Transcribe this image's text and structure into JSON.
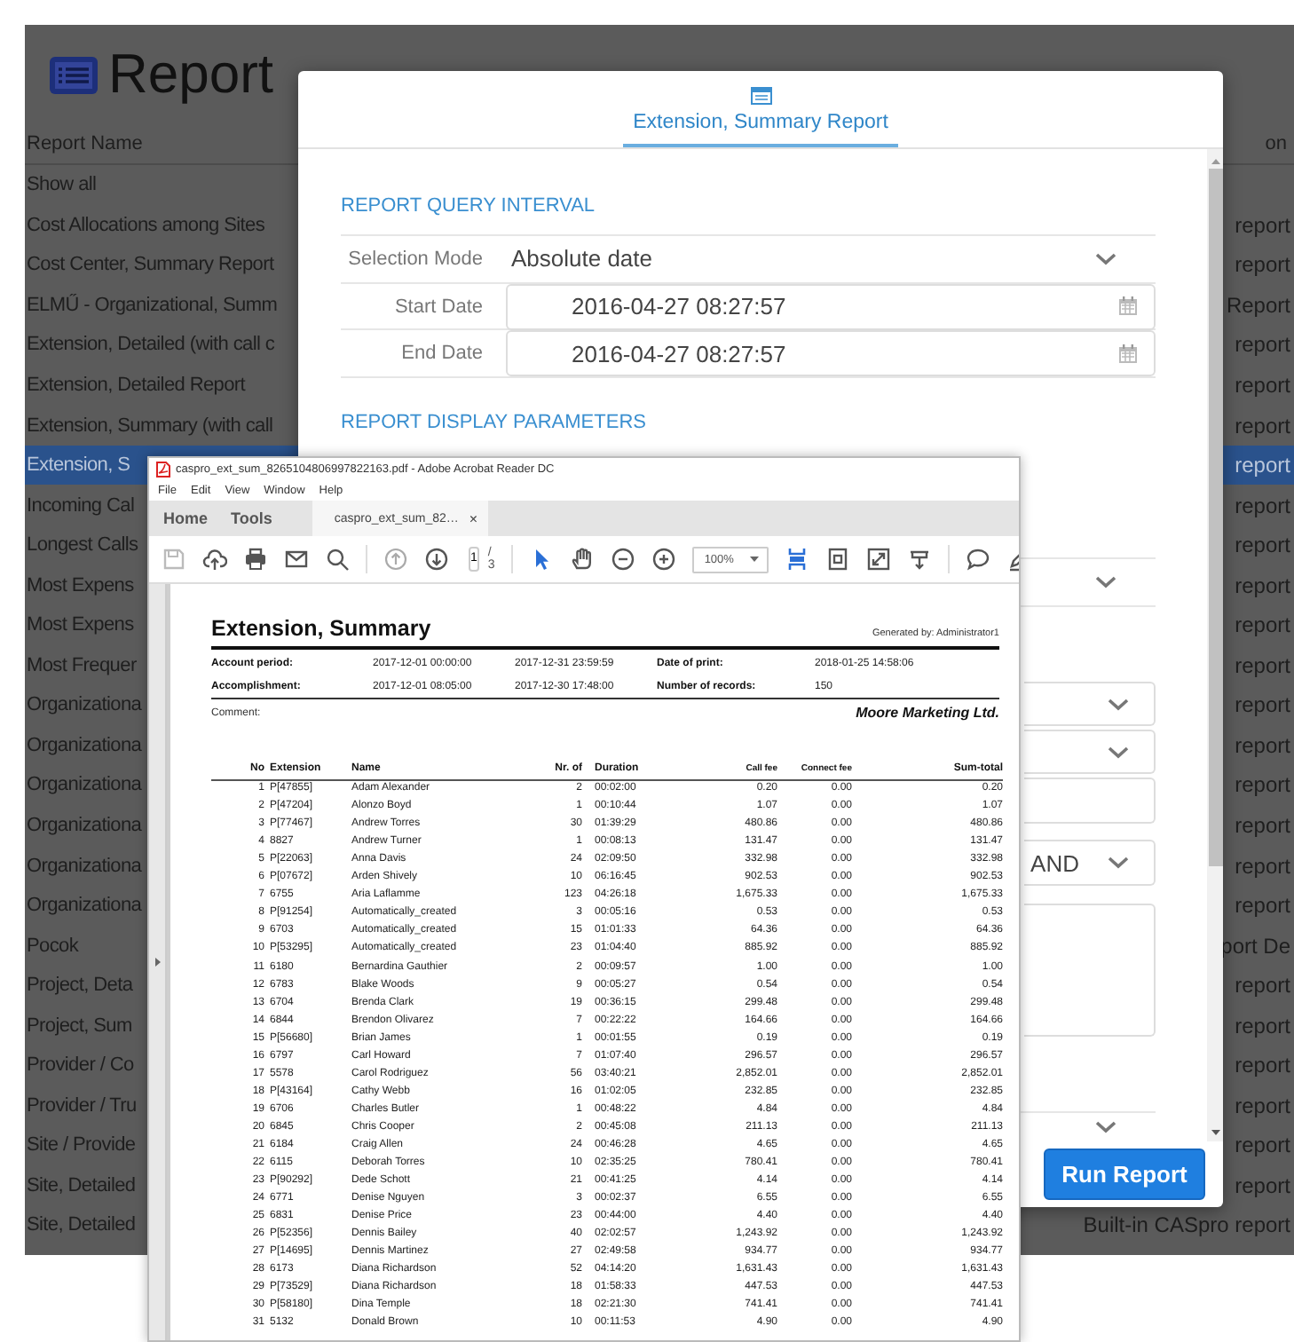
{
  "page": {
    "title": "Report",
    "columns": [
      "Report Name",
      "on"
    ],
    "rows": [
      {
        "report_name": "Show all",
        "selected": false
      },
      {
        "report_name": "Cost Allocations among Sites",
        "column_2": "report",
        "selected": false
      },
      {
        "report_name": "Cost Center, Summary Report",
        "column_2": "report",
        "selected": false
      },
      {
        "report_name": "ELMŰ - Organizational, Summ",
        "column_2": "Report",
        "selected": false
      },
      {
        "report_name": "Extension, Detailed (with call c",
        "column_2": "report",
        "selected": false
      },
      {
        "report_name": "Extension, Detailed Report",
        "column_2": "report",
        "selected": false
      },
      {
        "report_name": "Extension, Summary (with call",
        "column_2": "report",
        "selected": false
      },
      {
        "report_name": "Extension, S",
        "column_2": "report",
        "selected": true
      },
      {
        "report_name": "Incoming Cal",
        "column_2": "report",
        "selected": false
      },
      {
        "report_name": "Longest Calls",
        "column_2": "report",
        "selected": false
      },
      {
        "report_name": "Most Expens",
        "column_2": "report",
        "selected": false
      },
      {
        "report_name": "Most Expens",
        "column_2": "report",
        "selected": false
      },
      {
        "report_name": "Most Frequer",
        "column_2": "report",
        "selected": false
      },
      {
        "report_name": "Organizationa",
        "column_2": "report",
        "selected": false
      },
      {
        "report_name": "Organizationa",
        "column_2": "report",
        "selected": false
      },
      {
        "report_name": "Organizationa",
        "column_2": "report",
        "selected": false
      },
      {
        "report_name": "Organizationa",
        "column_2": "report",
        "selected": false
      },
      {
        "report_name": "Organizationa",
        "column_2": "report",
        "selected": false
      },
      {
        "report_name": "Organizationa",
        "column_2": "report",
        "selected": false
      },
      {
        "report_name": "Pocok",
        "column_2": "port De",
        "selected": false
      },
      {
        "report_name": "Project, Deta",
        "column_2": "report",
        "selected": false
      },
      {
        "report_name": "Project, Sum",
        "column_2": "report",
        "selected": false
      },
      {
        "report_name": "Provider / Co",
        "column_2": "report",
        "selected": false
      },
      {
        "report_name": "Provider / Tru",
        "column_2": "report",
        "selected": false
      },
      {
        "report_name": "Site / Provide",
        "column_2": "report",
        "selected": false
      },
      {
        "report_name": "Site, Detailed",
        "column_2": "report",
        "selected": false
      },
      {
        "report_name": "Site, Detailed",
        "column_2": "Built-in CASpro report",
        "selected": false
      }
    ]
  },
  "modal": {
    "tab": {
      "label": "Extension, Summary Report",
      "selected": true
    },
    "query_title": "REPORT QUERY INTERVAL",
    "query_fields": [
      {
        "kind": "select",
        "label": "Selection Mode",
        "value": "Absolute date"
      },
      {
        "kind": "date",
        "label": "Start Date",
        "value": "2016-04-27 08:27:57"
      },
      {
        "kind": "date",
        "label": "End Date",
        "value": "2016-04-27 08:27:57"
      }
    ],
    "display_title": "REPORT DISPLAY PARAMETERS",
    "display_fields": [
      {
        "kind": "select-row"
      },
      {
        "kind": "select"
      },
      {
        "kind": "select"
      },
      {
        "kind": "input"
      },
      {
        "kind": "select",
        "value": "AND"
      },
      {
        "kind": "textarea"
      },
      {
        "kind": "select-row"
      }
    ],
    "run_button": "Run Report"
  },
  "pdf": {
    "title": "caspro_ext_sum_8265104806997822163.pdf - Adobe Acrobat Reader DC",
    "menu": [
      "File",
      "Edit",
      "View",
      "Window",
      "Help"
    ],
    "nav": [
      "Home",
      "Tools"
    ],
    "tab": {
      "label": "caspro_ext_sum_82…",
      "close": "×",
      "selected": true
    },
    "page_number": "1",
    "page_count": "/ 3",
    "zoom": "100%",
    "document": {
      "title": "Extension, Summary",
      "generated_by": "Generated by: Administrator1",
      "info": [
        [
          "Account period:",
          "2017-12-01 00:00:00",
          "2017-12-31 23:59:59",
          "Date of print:",
          "2018-01-25 14:58:06"
        ],
        [
          "Accomplishment:",
          "2017-12-01 08:05:00",
          "2017-12-30 17:48:00",
          "Number of records:",
          "150"
        ]
      ],
      "comment_label": "Comment:",
      "company": "Moore Marketing Ltd.",
      "columns": [
        "No",
        "Extension",
        "Name",
        "Nr. of",
        "Duration",
        "Call fee",
        "Connect fee",
        "Sum-total"
      ],
      "rows": [
        [
          "1",
          "P[47855]",
          "Adam Alexander",
          "2",
          "00:02:00",
          "0.20",
          "0.00",
          "0.20"
        ],
        [
          "2",
          "P[47204]",
          "Alonzo Boyd",
          "1",
          "00:10:44",
          "1.07",
          "0.00",
          "1.07"
        ],
        [
          "3",
          "P[77467]",
          "Andrew Torres",
          "30",
          "01:39:29",
          "480.86",
          "0.00",
          "480.86"
        ],
        [
          "4",
          "8827",
          "Andrew Turner",
          "1",
          "00:08:13",
          "131.47",
          "0.00",
          "131.47"
        ],
        [
          "5",
          "P[22063]",
          "Anna Davis",
          "24",
          "02:09:50",
          "332.98",
          "0.00",
          "332.98"
        ],
        [
          "6",
          "P[07672]",
          "Arden Shively",
          "10",
          "06:16:45",
          "902.53",
          "0.00",
          "902.53"
        ],
        [
          "7",
          "6755",
          "Aria Laflamme",
          "123",
          "04:26:18",
          "1,675.33",
          "0.00",
          "1,675.33"
        ],
        [
          "8",
          "P[91254]",
          "Automatically_created",
          "3",
          "00:05:16",
          "0.53",
          "0.00",
          "0.53"
        ],
        [
          "9",
          "6703",
          "Automatically_created",
          "15",
          "01:01:33",
          "64.36",
          "0.00",
          "64.36"
        ],
        [
          "10",
          "P[53295]",
          "Automatically_created",
          "23",
          "01:04:40",
          "885.92",
          "0.00",
          "885.92"
        ],
        [
          "11",
          "6180",
          "Bernardina Gauthier",
          "2",
          "00:09:57",
          "1.00",
          "0.00",
          "1.00"
        ],
        [
          "12",
          "6783",
          "Blake Woods",
          "9",
          "00:05:27",
          "0.54",
          "0.00",
          "0.54"
        ],
        [
          "13",
          "6704",
          "Brenda Clark",
          "19",
          "00:36:15",
          "299.48",
          "0.00",
          "299.48"
        ],
        [
          "14",
          "6844",
          "Brendon Olivarez",
          "7",
          "00:22:22",
          "164.66",
          "0.00",
          "164.66"
        ],
        [
          "15",
          "P[56680]",
          "Brian James",
          "1",
          "00:01:55",
          "0.19",
          "0.00",
          "0.19"
        ],
        [
          "16",
          "6797",
          "Carl Howard",
          "7",
          "01:07:40",
          "296.57",
          "0.00",
          "296.57"
        ],
        [
          "17",
          "5578",
          "Carol Rodriguez",
          "56",
          "03:40:21",
          "2,852.01",
          "0.00",
          "2,852.01"
        ],
        [
          "18",
          "P[43164]",
          "Cathy Webb",
          "16",
          "01:02:05",
          "232.85",
          "0.00",
          "232.85"
        ],
        [
          "19",
          "6706",
          "Charles Butler",
          "1",
          "00:48:22",
          "4.84",
          "0.00",
          "4.84"
        ],
        [
          "20",
          "6845",
          "Chris Cooper",
          "2",
          "00:45:08",
          "211.13",
          "0.00",
          "211.13"
        ],
        [
          "21",
          "6184",
          "Craig Allen",
          "24",
          "00:46:28",
          "4.65",
          "0.00",
          "4.65"
        ],
        [
          "22",
          "6115",
          "Deborah Torres",
          "10",
          "02:35:25",
          "780.41",
          "0.00",
          "780.41"
        ],
        [
          "23",
          "P[90292]",
          "Dede Schott",
          "21",
          "00:41:25",
          "4.14",
          "0.00",
          "4.14"
        ],
        [
          "24",
          "6771",
          "Denise Nguyen",
          "3",
          "00:02:37",
          "6.55",
          "0.00",
          "6.55"
        ],
        [
          "25",
          "6831",
          "Denise Price",
          "23",
          "00:44:00",
          "4.40",
          "0.00",
          "4.40"
        ],
        [
          "26",
          "P[52356]",
          "Dennis Bailey",
          "40",
          "02:02:57",
          "1,243.92",
          "0.00",
          "1,243.92"
        ],
        [
          "27",
          "P[14695]",
          "Dennis Martinez",
          "27",
          "02:49:58",
          "934.77",
          "0.00",
          "934.77"
        ],
        [
          "28",
          "6173",
          "Diana Richardson",
          "52",
          "04:14:20",
          "1,631.43",
          "0.00",
          "1,631.43"
        ],
        [
          "29",
          "P[73529]",
          "Diana Richardson",
          "18",
          "01:58:33",
          "447.53",
          "0.00",
          "447.53"
        ],
        [
          "30",
          "P[58180]",
          "Dina Temple",
          "18",
          "02:21:30",
          "741.41",
          "0.00",
          "741.41"
        ],
        [
          "31",
          "5132",
          "Donald Brown",
          "10",
          "00:11:53",
          "4.90",
          "0.00",
          "4.90"
        ]
      ]
    }
  }
}
